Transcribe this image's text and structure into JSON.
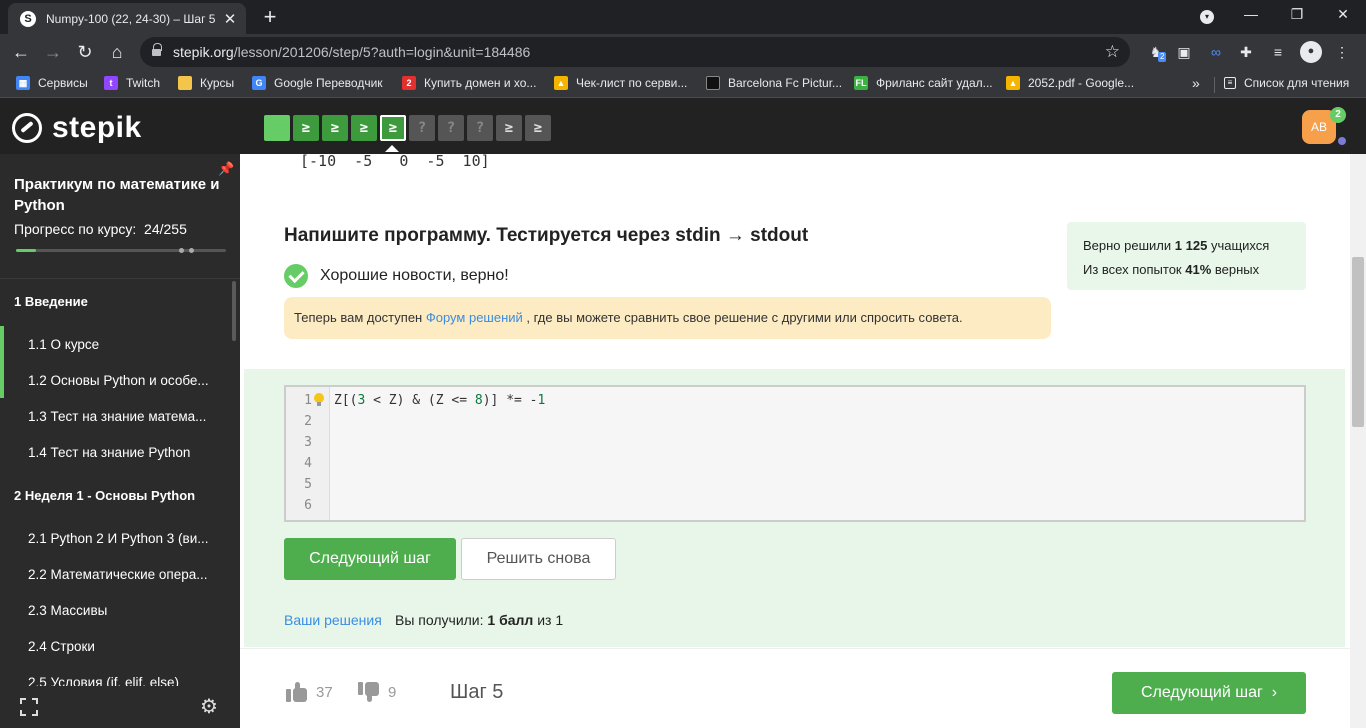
{
  "browser": {
    "tab_title": "Numpy-100 (22, 24-30) – Шаг 5 –",
    "tab_favicon": "stepik-icon",
    "url_host": "stepik.org",
    "url_path": "/lesson/201206/step/5?auth=login&unit=184486",
    "ext_badge": "2",
    "bookmarks": [
      {
        "label": "Сервисы",
        "icon": "apps-icon",
        "color": "#4285f4"
      },
      {
        "label": "Twitch",
        "icon": "twitch-icon",
        "color": "#9146ff"
      },
      {
        "label": "Курсы",
        "icon": "folder-icon",
        "color": "#f3c64b"
      },
      {
        "label": "Google Переводчик",
        "icon": "translate-icon",
        "color": "#4285f4"
      },
      {
        "label": "Купить домен и хо...",
        "icon": "domain-icon",
        "color": "#e03030"
      },
      {
        "label": "Чек-лист по серви...",
        "icon": "drive-icon",
        "color": "#f4b400"
      },
      {
        "label": "Barcelona Fc Pictur...",
        "icon": "image-icon",
        "color": "#111111"
      },
      {
        "label": "Фриланс сайт удал...",
        "icon": "fl-icon",
        "color": "#3cb043"
      },
      {
        "label": "2052.pdf - Google...",
        "icon": "drive-icon",
        "color": "#f4b400"
      }
    ],
    "reading_list": "Список для чтения"
  },
  "header": {
    "logo_text": "stepik",
    "avatar_initials": "AB",
    "avatar_badge": "2",
    "steps": [
      {
        "type": "done",
        "glyph": ""
      },
      {
        "type": "done-code",
        "glyph": "≥"
      },
      {
        "type": "done-code",
        "glyph": "≥"
      },
      {
        "type": "done-code",
        "glyph": "≥"
      },
      {
        "type": "current",
        "glyph": "≥"
      },
      {
        "type": "todo-q",
        "glyph": "?"
      },
      {
        "type": "todo-q",
        "glyph": "?"
      },
      {
        "type": "todo-q",
        "glyph": "?"
      },
      {
        "type": "todo-code",
        "glyph": "≥"
      },
      {
        "type": "todo-code",
        "glyph": "≥"
      }
    ]
  },
  "sidebar": {
    "course_title": "Практикум по математике и Python",
    "progress_label": "Прогресс по курсу:",
    "progress_value": "24/255",
    "progress_fraction": 0.094,
    "modules": [
      {
        "label": "1  Введение"
      },
      {
        "label": "2  Неделя 1 - Основы Python"
      }
    ],
    "lessons": [
      {
        "label": "1.1  О курсе",
        "done": true
      },
      {
        "label": "1.2  Основы Python и особе...",
        "done": true
      },
      {
        "label": "1.3  Тест на знание матема...",
        "done": false
      },
      {
        "label": "1.4  Тест на знание Python",
        "done": false
      },
      {
        "label": "2.1  Python 2 И Python 3 (ви...",
        "done": false
      },
      {
        "label": "2.2  Математические опера...",
        "done": false
      },
      {
        "label": "2.3  Массивы",
        "done": false
      },
      {
        "label": "2.4  Строки",
        "done": false
      },
      {
        "label": "2.5  Условия (if. elif. else)",
        "done": false
      }
    ]
  },
  "main": {
    "output_line": "[-10  -5   0  -5  10]",
    "task_title": "Напишите программу. Тестируется через stdin → stdout",
    "stats": {
      "line1_prefix": "Верно решили",
      "line1_count": "1 125",
      "line1_suffix": "учащихся",
      "line2_prefix": "Из всех попыток",
      "line2_percent": "41%",
      "line2_suffix": "верных"
    },
    "success_text": "Хорошие новости, верно!",
    "info": {
      "before": "Теперь вам доступен",
      "link": "Форум решений",
      "after": ", где вы можете сравнить свое решение с другими или спросить совета."
    },
    "editor": {
      "line_numbers": [
        "1",
        "2",
        "3",
        "4",
        "5",
        "6"
      ],
      "code_parts": [
        "Z[(",
        "3",
        " < Z) & (Z <= ",
        "8",
        ")] *= -",
        "1"
      ]
    },
    "next_step_label": "Следующий шаг",
    "retry_label": "Решить снова",
    "solutions_link": "Ваши решения",
    "score_prefix": "Вы получили:",
    "score_value": "1 балл",
    "score_suffix": "из 1",
    "likes": "37",
    "dislikes": "9",
    "step_label": "Шаг 5",
    "next_step_bottom": "Следующий шаг"
  }
}
